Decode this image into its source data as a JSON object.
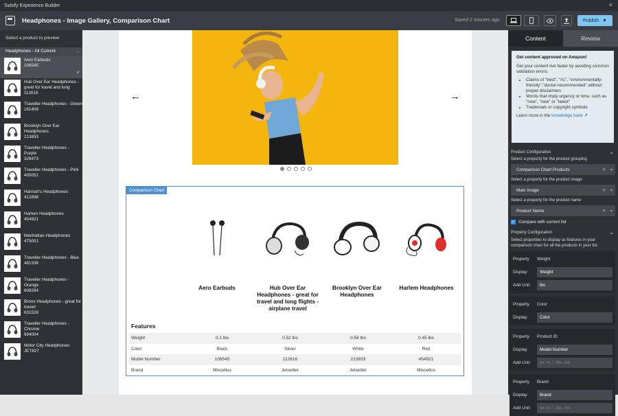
{
  "app": {
    "window_title": "Salsify Experience Builder",
    "close": "×"
  },
  "toolbar": {
    "title": "Headphones - Image Gallery, Comparison Chart",
    "saved": "Saved 2 minutes ago",
    "publish": "Publish"
  },
  "left": {
    "header": "Select a product to preview",
    "selector": "Headphones - All Current",
    "products": [
      {
        "name": "Aero Earbuds",
        "id": "106545"
      },
      {
        "name": "Hub Over Ear Headphones - great for travel and long",
        "id": "112616"
      },
      {
        "name": "Traveller Headphones - Green",
        "id": "161409"
      },
      {
        "name": "Brooklyn Over Ear Headphones",
        "id": "213833"
      },
      {
        "name": "Traveller Headphones - Purple",
        "id": "328473"
      },
      {
        "name": "Traveller Headphones - Pink",
        "id": "405051"
      },
      {
        "name": "Hannah's Headphones",
        "id": "412898"
      },
      {
        "name": "Harlem Headphones",
        "id": "454921"
      },
      {
        "name": "Manhattan Headphones",
        "id": "475001"
      },
      {
        "name": "Traveller Headphones - Blue",
        "id": "481336"
      },
      {
        "name": "Traveller Headphones - Orange",
        "id": "608284"
      },
      {
        "name": "Bronx Headphones - great for travel!",
        "id": "631528"
      },
      {
        "name": "Traveller Headphones - Chrome",
        "id": "694004"
      },
      {
        "name": "Motor City Headphones",
        "id": "JET827"
      }
    ]
  },
  "comparison": {
    "tag": "Comparison Chart",
    "products": [
      "Aero Earbuds",
      "Hub Over Ear Headphones - great for travel and long flights - airplane travel",
      "Brooklyn Over Ear Headphones",
      "Harlem Headphones"
    ],
    "features_title": "Features",
    "rows": [
      {
        "label": "Weight",
        "values": [
          "0.1 lbs",
          "0.52 lbs",
          "0.58 lbs",
          "0.45 lbs"
        ]
      },
      {
        "label": "Color",
        "values": [
          "Black",
          "Silver",
          "White",
          "Red"
        ]
      },
      {
        "label": "Model Number",
        "values": [
          "106545",
          "112616",
          "213833",
          "454921"
        ]
      },
      {
        "label": "Brand",
        "values": [
          "Miscellus",
          "Jetsetter",
          "Jetsetter",
          "Miscellus"
        ]
      }
    ]
  },
  "right": {
    "tabs": [
      "Content",
      "Review"
    ],
    "tip": {
      "title": "Get content approved on Amazon!",
      "intro": "Get your content live faster by avoiding common validation errors:",
      "items": [
        "Claims of \"best\", \"#1\", \"environmentally-friendly\",\"doctor-recommended\" without proper disclaimers",
        "Words that imply urgency or time, such as \"now\", \"new\" or \"latest\"",
        "Trademark or copyright symbols"
      ],
      "more": "Learn more in the",
      "link": "knowledge base"
    },
    "product_config": {
      "title": "Product Configuration",
      "grouping_label": "Select a property for the product grouping",
      "grouping_value": "Comparison Chart Products",
      "image_label": "Select a property for the product image",
      "image_value": "Main Image",
      "name_label": "Select a property for the product name",
      "name_value": "Product Name",
      "compare_label": "Compare with current list"
    },
    "property_config": {
      "title": "Property Configuration",
      "desc": "Select properties to display as features in your comparison chart for all the products in your list.",
      "property_label": "Property",
      "display_label": "Display",
      "unit_label": "Add Unit:",
      "unit_placeholder": "ex: in, \", lbs, cm",
      "blocks": [
        {
          "property": "Weight",
          "display": "Weight",
          "unit": "lbs"
        },
        {
          "property": "Color",
          "display": "Color"
        },
        {
          "property": "Product ID",
          "display": "Model Number",
          "unit": ""
        },
        {
          "property": "Brand",
          "display": "Brand",
          "unit": ""
        }
      ]
    }
  }
}
